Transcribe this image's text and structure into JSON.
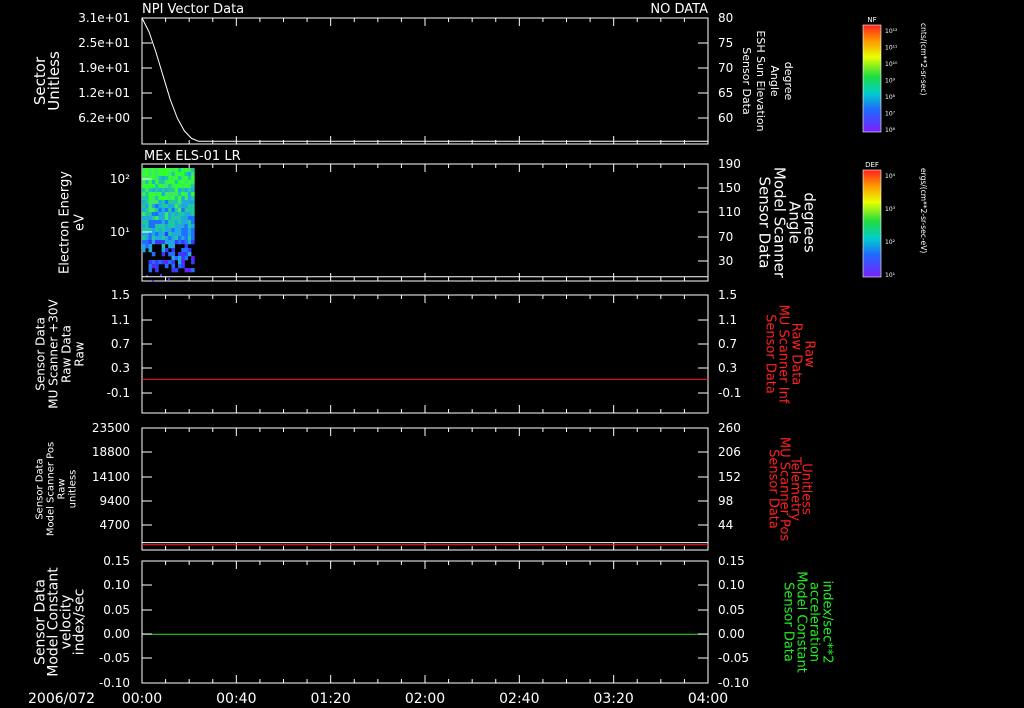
{
  "header": {
    "top_title": "NPI Vector Data",
    "status": "NO DATA"
  },
  "time_axis": {
    "date_label": "2006/072",
    "ticks": [
      "00:00",
      "00:40",
      "01:20",
      "02:00",
      "02:40",
      "03:20",
      "04:00"
    ],
    "range_hours": [
      0,
      4
    ]
  },
  "colors": {
    "white": "#ffffff",
    "red": "#ff2020",
    "green": "#22ee22",
    "background": "#000000"
  },
  "colorbars": [
    {
      "label": "NF",
      "units": "cnts/(cm**2-sr-sec)",
      "ticks": [
        "10¹²",
        "10¹¹",
        "10¹⁰",
        "10⁹",
        "10⁸",
        "10⁷",
        "10⁶"
      ]
    },
    {
      "label": "DEF",
      "units": "ergs/(cm**2-sr-sec-eV)",
      "ticks": [
        "10⁴",
        "10³",
        "10²",
        "10¹"
      ]
    }
  ],
  "chart_data": [
    {
      "type": "line",
      "panel": 1,
      "ylabel_left": [
        "Sector",
        "Unitless"
      ],
      "yticks_left": [
        "3.1e+01",
        "2.5e+01",
        "1.9e+01",
        "1.2e+01",
        "6.2e+00"
      ],
      "ylabel_right": [
        "Sensor Data",
        "ESH Sun Elevation",
        "Angle",
        "degree"
      ],
      "yticks_right": [
        "80",
        "75",
        "70",
        "65",
        "60"
      ],
      "ylim_right": [
        53,
        80
      ],
      "series": [
        {
          "color": "white",
          "x_hours": [
            0.0,
            0.05,
            0.1,
            0.15,
            0.2,
            0.25,
            0.3,
            0.35,
            0.4,
            4.0
          ],
          "y_degree": [
            80,
            77,
            72.5,
            67.5,
            62.5,
            58.5,
            55.8,
            54.2,
            53.6,
            53.6
          ]
        }
      ]
    },
    {
      "type": "heatmap",
      "panel": 2,
      "title": "MEx ELS-01 LR",
      "ylabel_left": [
        "Electron Energy",
        "eV"
      ],
      "yticks_left": [
        "10²",
        "10¹"
      ],
      "log_scale": true,
      "ylabel_right": [
        "Sensor Data",
        "Model Scanner",
        "Angle",
        "degrees"
      ],
      "yticks_right": [
        "190",
        "150",
        "110",
        "70",
        "30"
      ],
      "data_time_range_hours": [
        0.0,
        0.37
      ],
      "series": [
        {
          "color": "white",
          "x_hours": [
            0.0,
            4.0
          ],
          "y_degrees": [
            7,
            7
          ]
        }
      ]
    },
    {
      "type": "line",
      "panel": 3,
      "ylabel_left": [
        "Sensor Data",
        "MU Scanner +30V",
        "Raw Data",
        "Raw"
      ],
      "yticks_left": [
        "1.5",
        "1.1",
        "0.7",
        "0.3",
        "-0.1"
      ],
      "ylabel_right": [
        "Sensor Data",
        "MU Scanner Inf",
        "Raw Data",
        "Raw"
      ],
      "yticks_right": [
        "1.5",
        "1.1",
        "0.7",
        "0.3",
        "-0.1"
      ],
      "ylim": [
        -0.6,
        1.5
      ],
      "series": [
        {
          "color": "red",
          "x_hours": [
            0.0,
            4.0
          ],
          "y": [
            0.0,
            0.0
          ]
        }
      ]
    },
    {
      "type": "line",
      "panel": 4,
      "ylabel_left": [
        "Sensor Data",
        "Model Scanner Pos",
        "Raw",
        "unitless"
      ],
      "yticks_left": [
        "23500",
        "18800",
        "14100",
        "9400",
        "4700"
      ],
      "ylabel_right": [
        "Sensor Data",
        "MU Scanner Pos",
        "Telemetry",
        "Unitless"
      ],
      "yticks_right": [
        "260",
        "206",
        "152",
        "98",
        "44"
      ],
      "ylim_left": [
        -1100,
        23500
      ],
      "series": [
        {
          "color": "white",
          "x_hours": [
            0.0,
            4.0
          ],
          "y": [
            400,
            400
          ]
        },
        {
          "color": "red",
          "x_hours": [
            0.0,
            4.0
          ],
          "y": [
            -50,
            -50
          ]
        }
      ]
    },
    {
      "type": "line",
      "panel": 5,
      "ylabel_left": [
        "Sensor Data",
        "Model Constant",
        "velocity",
        "index/sec"
      ],
      "yticks_left": [
        "0.15",
        "0.10",
        "0.05",
        "0.00",
        "-0.05",
        "-0.10"
      ],
      "ylabel_right": [
        "Sensor Data",
        "Model Constant",
        "acceleration",
        "index/sec**2"
      ],
      "yticks_right": [
        "0.15",
        "0.10",
        "0.05",
        "0.00",
        "-0.05",
        "-0.10"
      ],
      "ylim": [
        -0.1,
        0.15
      ],
      "series": [
        {
          "color": "green",
          "x_hours": [
            0.0,
            4.0
          ],
          "y": [
            0.0,
            0.0
          ]
        }
      ]
    }
  ]
}
